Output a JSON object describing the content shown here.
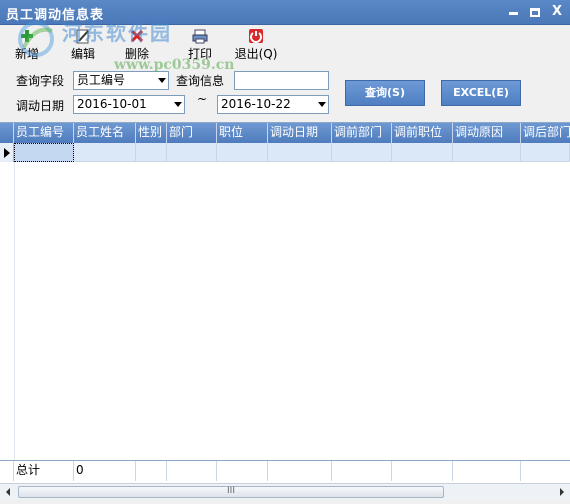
{
  "window": {
    "title": "员工调动信息表",
    "controls": {
      "minimize_icon": "minimize-icon",
      "maximize_icon": "maximize-icon",
      "close_icon": "close-icon",
      "close_glyph": "X"
    }
  },
  "watermark": {
    "text": "河东软件园",
    "url": "www.pc0359.cn"
  },
  "toolbar": {
    "new_label": "新增",
    "edit_label": "编辑",
    "delete_label": "删除",
    "print_label": "打印",
    "exit_label": "退出(Q)"
  },
  "search": {
    "field_label": "查询字段",
    "field_value": "员工编号",
    "info_label": "查询信息",
    "info_value": "",
    "date_label": "调动日期",
    "date_from": "2016-10-01",
    "date_sep": "~",
    "date_to": "2016-10-22",
    "query_button": "查询(S)",
    "excel_button": "EXCEL(E)"
  },
  "grid": {
    "columns": [
      "员工编号",
      "员工姓名",
      "性别",
      "部门",
      "职位",
      "调动日期",
      "调前部门",
      "调前职位",
      "调动原因",
      "调后部门"
    ],
    "rows": [
      [
        "",
        "",
        "",
        "",
        "",
        "",
        "",
        "",
        "",
        ""
      ]
    ],
    "footer": {
      "total_label": "总计",
      "total_value": "0"
    }
  },
  "scrollbar": {
    "thumb_grip": "III"
  },
  "colors": {
    "titlebar": "#4a78b8",
    "grid_header": "#5a87c6",
    "selected_row": "#dbe8f8",
    "button": "#5a88c8"
  }
}
